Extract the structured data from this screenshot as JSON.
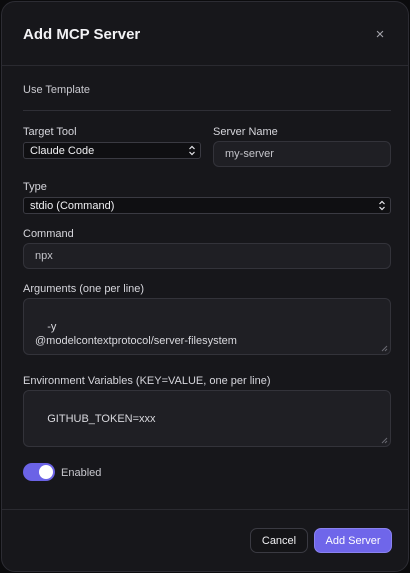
{
  "dialog": {
    "title": "Add MCP Server",
    "close_glyph": "×"
  },
  "template": {
    "label": "Use Template"
  },
  "target_tool": {
    "label": "Target Tool",
    "value": "Claude Code"
  },
  "server_name": {
    "label": "Server Name",
    "placeholder": "my-server"
  },
  "type": {
    "label": "Type",
    "value": "stdio (Command)"
  },
  "command": {
    "label": "Command",
    "placeholder": "npx"
  },
  "arguments": {
    "label": "Arguments (one per line)",
    "placeholder": "-y\n@modelcontextprotocol/server-filesystem"
  },
  "env": {
    "label": "Environment Variables (KEY=VALUE, one per line)",
    "placeholder": "GITHUB_TOKEN=xxx"
  },
  "enabled": {
    "label": "Enabled",
    "on": true
  },
  "footer": {
    "cancel_label": "Cancel",
    "add_label": "Add Server"
  },
  "colors": {
    "accent": "#6f66ea",
    "toggle_on": "#6b63e6",
    "surface": "#17171b"
  },
  "icons": {
    "close": "close-icon",
    "select_arrows": "chevron-up-down-icon"
  }
}
